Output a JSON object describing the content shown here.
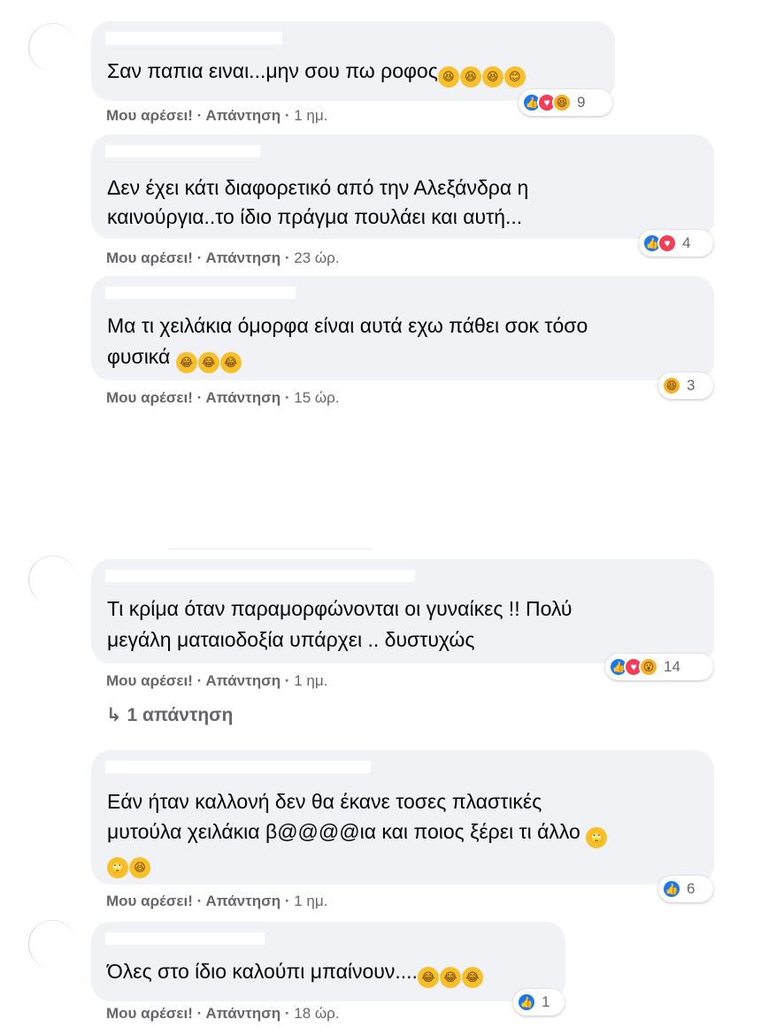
{
  "actions": {
    "like_label": "Μου αρέσει!",
    "reply_label": "Απάντηση",
    "separator": "·"
  },
  "comments": [
    {
      "line1": "Σαν παπια ειναι...μην σου πω ροφος",
      "line2": "",
      "emoji": "🤣🤣🤣😊",
      "time": "1 ημ.",
      "reactions": [
        "like",
        "love",
        "haha"
      ],
      "reaction_count": "9"
    },
    {
      "line1": "Δεν έχει κάτι διαφορετικό από την Αλεξάνδρα η",
      "line2": "καινούργια..το ίδιο πράγμα πουλάει και αυτή...",
      "emoji": "",
      "time": "23 ώρ.",
      "reactions": [
        "like",
        "love"
      ],
      "reaction_count": "4"
    },
    {
      "line1": "Μα τι χειλάκια όμορφα είναι αυτά εχω πάθει σοκ τόσο",
      "line2": "φυσικά",
      "emoji": "😂😂😂",
      "time": "15 ώρ.",
      "reactions": [
        "haha"
      ],
      "reaction_count": "3"
    },
    {
      "line1": "Τι κρίμα όταν παραμορφώνονται οι γυναίκες !! Πολύ",
      "line2": "μεγάλη ματαιοδοξία υπάρχει .. δυστυχώς",
      "emoji": "",
      "time": "1 ημ.",
      "reactions": [
        "like",
        "love",
        "wow"
      ],
      "reaction_count": "14"
    },
    {
      "line1": "Εάν ήταν καλλονή δεν θα έκανε τοσες πλαστικές",
      "line2": "μυτούλα χειλάκια β@@@@ια και ποιος ξέρει τι άλλο",
      "line3_emoji": "🙄🤣",
      "emoji_end": "🙄",
      "time": "1 ημ.",
      "reactions": [
        "like"
      ],
      "reaction_count": "6"
    },
    {
      "line1": "Όλες στο ίδιο καλούπι μπαίνουν....",
      "line2": "",
      "emoji": "😂😂😂",
      "time": "18 ώρ.",
      "reactions": [
        "like"
      ],
      "reaction_count": "1"
    }
  ],
  "replies_link": {
    "arrow": "↳",
    "label": "1 απάντηση"
  },
  "icons": {
    "like": "like-icon",
    "love": "love-icon",
    "haha": "haha-icon",
    "wow": "wow-icon"
  },
  "colors": {
    "bubble": "#f0f2f5",
    "meta": "#65676b",
    "like": "#1877f2",
    "love": "#f33e58",
    "haha": "#f7b125"
  }
}
